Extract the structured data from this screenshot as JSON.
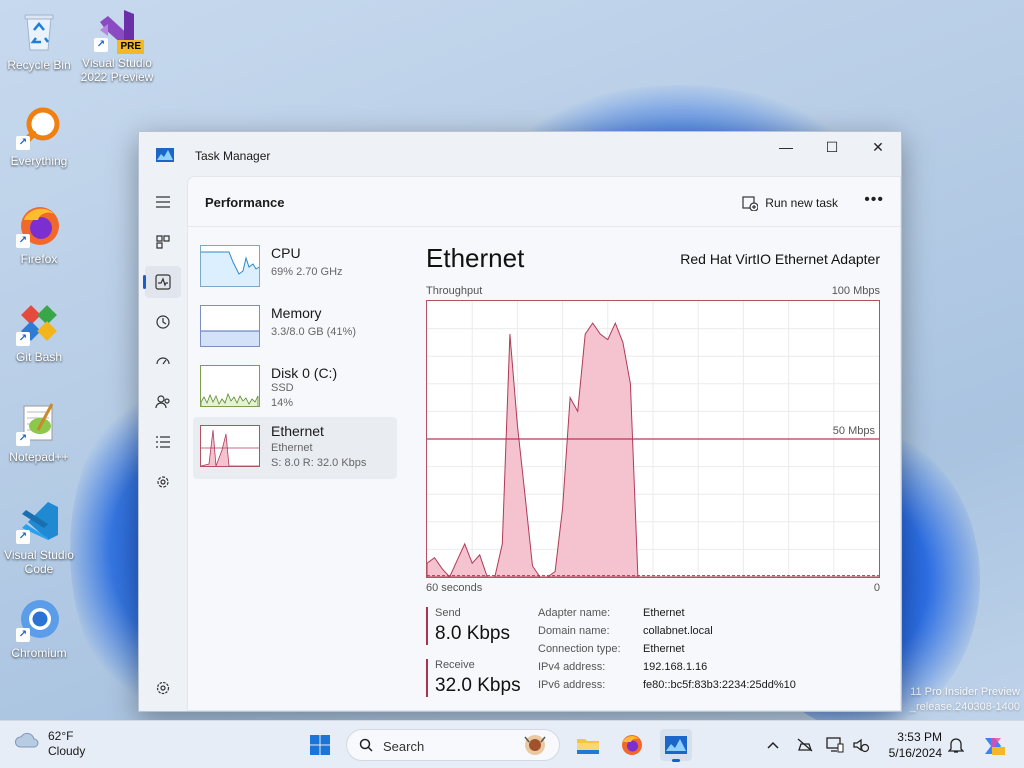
{
  "desktop": {
    "icons": [
      {
        "label": "Recycle Bin",
        "icon": "recycle-bin-icon"
      },
      {
        "label": "Visual Studio 2022 Preview",
        "badge": "PRE",
        "icon": "visual-studio-preview-icon"
      },
      {
        "label": "Everything",
        "icon": "everything-search-icon"
      },
      {
        "label": "Firefox",
        "icon": "firefox-icon"
      },
      {
        "label": "Git Bash",
        "icon": "git-bash-icon"
      },
      {
        "label": "Notepad++",
        "icon": "notepadpp-icon"
      },
      {
        "label": "Visual Studio Code",
        "icon": "vscode-icon"
      },
      {
        "label": "Chromium",
        "icon": "chromium-icon"
      }
    ],
    "watermark": [
      "11 Pro Insider Preview",
      "_release.240308-1400"
    ]
  },
  "window": {
    "title": "Task Manager",
    "controls": {
      "minimize": "—",
      "maximize": "☐",
      "close": "✕"
    }
  },
  "sidebar": {
    "items": [
      "hamburger-icon",
      "processes-icon",
      "performance-icon",
      "app-history-icon",
      "startup-apps-icon",
      "users-icon",
      "details-icon",
      "services-icon",
      "settings-icon"
    ],
    "active": "performance-icon"
  },
  "header": {
    "title": "Performance",
    "run_task": "Run new task",
    "more": "•••"
  },
  "list": [
    {
      "name": "CPU",
      "sub1": "69%  2.70 GHz",
      "sub2": "",
      "sub3": ""
    },
    {
      "name": "Memory",
      "sub1": "3.3/8.0 GB (41%)",
      "sub2": "",
      "sub3": ""
    },
    {
      "name": "Disk 0 (C:)",
      "sub1": "SSD",
      "sub2": "14%",
      "sub3": ""
    },
    {
      "name": "Ethernet",
      "sub1": "Ethernet",
      "sub2": "S: 8.0  R: 32.0 Kbps",
      "sub3": ""
    }
  ],
  "detail": {
    "title": "Ethernet",
    "adapter": "Red Hat VirtIO Ethernet Adapter",
    "throughput_label": "Throughput",
    "max_label": "100 Mbps",
    "mid_label": "50 Mbps",
    "x_left": "60 seconds",
    "x_right": "0",
    "send_label": "Send",
    "send_value": "8.0 Kbps",
    "receive_label": "Receive",
    "receive_value": "32.0 Kbps",
    "info": [
      {
        "k": "Adapter name:",
        "v": "Ethernet"
      },
      {
        "k": "Domain name:",
        "v": "collabnet.local"
      },
      {
        "k": "Connection type:",
        "v": "Ethernet"
      },
      {
        "k": "IPv4 address:",
        "v": "192.168.1.16"
      },
      {
        "k": "IPv6 address:",
        "v": "fe80::bc5f:83b3:2234:25dd%10"
      }
    ]
  },
  "chart_data": {
    "type": "area",
    "title": "Ethernet",
    "xlabel": "60 seconds",
    "ylabel": "Throughput",
    "ylim": [
      0,
      100
    ],
    "x_range": [
      60,
      0
    ],
    "series": [
      {
        "name": "Receive",
        "color": "#b03a58",
        "x": [
          60,
          59,
          58,
          57,
          56,
          55,
          54,
          53,
          52,
          51,
          50,
          49,
          48,
          47,
          46,
          45,
          44,
          43,
          42,
          41,
          40,
          39,
          38,
          37,
          36,
          35,
          34,
          33,
          32,
          31,
          30,
          29,
          28,
          27,
          26,
          25,
          24,
          23,
          22,
          21,
          20,
          19,
          18,
          17,
          16,
          15,
          14,
          13,
          12,
          11,
          10,
          9,
          8,
          7,
          6,
          5,
          4,
          3,
          2,
          1,
          0
        ],
        "values": [
          5,
          7,
          3,
          0,
          6,
          12,
          5,
          8,
          0,
          0,
          12,
          88,
          55,
          30,
          4,
          0,
          0,
          2,
          25,
          65,
          60,
          88,
          92,
          88,
          86,
          92,
          85,
          70,
          0,
          0,
          0,
          0,
          0,
          0,
          0,
          0,
          0,
          0,
          0,
          0,
          0,
          0,
          0,
          0,
          0,
          0,
          0,
          0,
          0,
          0,
          0,
          0,
          0,
          0,
          0,
          0,
          0,
          0,
          0,
          0,
          0
        ]
      },
      {
        "name": "Send",
        "color": "#b03a58",
        "x": [
          60,
          0
        ],
        "values": [
          0.5,
          0.5
        ]
      }
    ],
    "reference_line": 50
  },
  "taskbar": {
    "weather_temp": "62°F",
    "weather_desc": "Cloudy",
    "search_placeholder": "Search",
    "time": "3:53 PM",
    "date": "5/16/2024"
  },
  "colors": {
    "accent": "#1a5fc9",
    "ethernet": "#b03a58",
    "ethernet_fill": "#f4c3cf"
  }
}
